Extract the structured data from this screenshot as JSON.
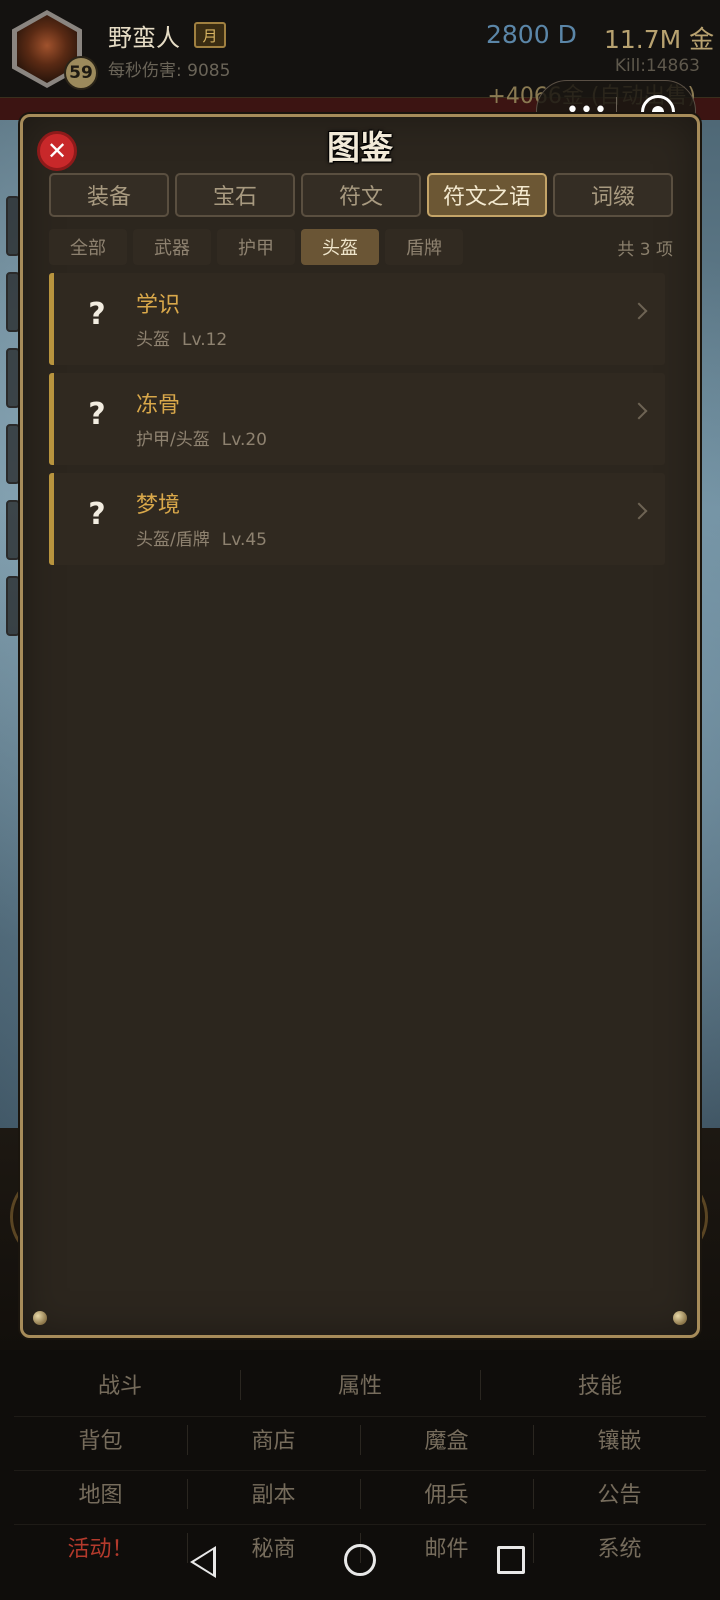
{
  "header": {
    "player_name": "野蛮人",
    "month_badge": "月",
    "level": "59",
    "dps": "每秒伤害: 9085",
    "currency_d": "2800 D",
    "currency_gold": "11.7M 金",
    "kill": "Kill:14863",
    "gold_gain": "+4066金 (自动出售)"
  },
  "capsule": {
    "more_icon": "more-dots-icon",
    "more_glyph": "•••",
    "close_icon": "target-circle-icon"
  },
  "modal": {
    "title": "图鉴",
    "close_glyph": "✕",
    "tabs": [
      {
        "label": "装备",
        "active": false
      },
      {
        "label": "宝石",
        "active": false
      },
      {
        "label": "符文",
        "active": false
      },
      {
        "label": "符文之语",
        "active": true
      },
      {
        "label": "词缀",
        "active": false
      }
    ],
    "subtabs": [
      {
        "label": "全部",
        "active": false
      },
      {
        "label": "武器",
        "active": false
      },
      {
        "label": "护甲",
        "active": false
      },
      {
        "label": "头盔",
        "active": true
      },
      {
        "label": "盾牌",
        "active": false
      }
    ],
    "total": "共 3 项",
    "entries": [
      {
        "icon": "?",
        "name": "学识",
        "type": "头盔",
        "level": "Lv.12"
      },
      {
        "icon": "?",
        "name": "冻骨",
        "type": "护甲/头盔",
        "level": "Lv.20"
      },
      {
        "icon": "?",
        "name": "梦境",
        "type": "头盔/盾牌",
        "level": "Lv.45"
      }
    ]
  },
  "menu": {
    "row1": [
      "战斗",
      "属性",
      "技能"
    ],
    "row2": [
      "背包",
      "商店",
      "魔盒",
      "镶嵌"
    ],
    "row3": [
      "地图",
      "副本",
      "佣兵",
      "公告"
    ],
    "row4": [
      "活动！",
      "秘商",
      "邮件",
      "系统"
    ]
  },
  "colors": {
    "accent_gold": "#d9a84a",
    "active_tab": "#6c5734",
    "close_red": "#c8282a",
    "currency_blue": "#5b86a8",
    "event_red": "#b43a2c"
  }
}
